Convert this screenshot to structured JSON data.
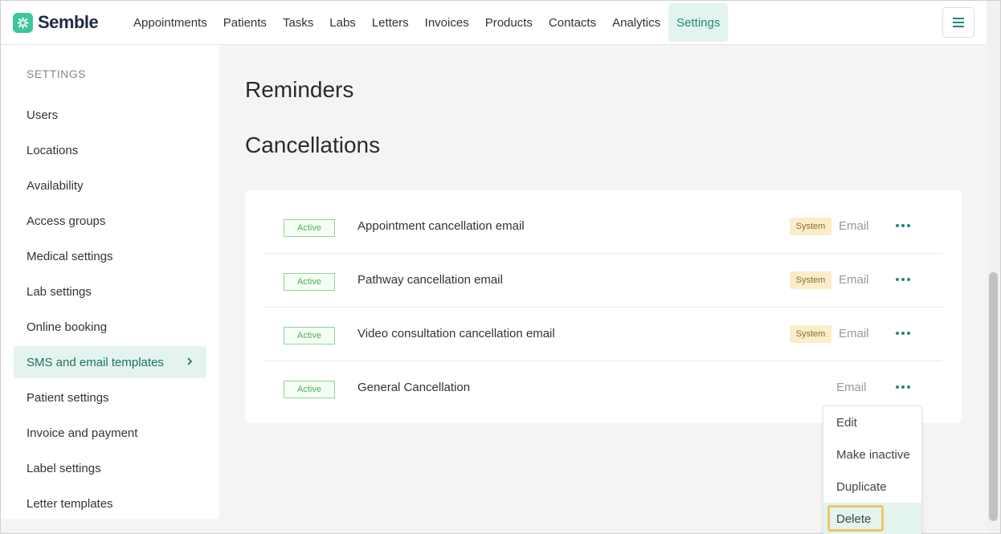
{
  "brand": {
    "name": "Semble",
    "color": "#3fc59b"
  },
  "nav": {
    "items": [
      "Appointments",
      "Patients",
      "Tasks",
      "Labs",
      "Letters",
      "Invoices",
      "Products",
      "Contacts",
      "Analytics",
      "Settings"
    ],
    "active": "Settings"
  },
  "sidebar": {
    "heading": "SETTINGS",
    "items": [
      {
        "label": "Users"
      },
      {
        "label": "Locations"
      },
      {
        "label": "Availability"
      },
      {
        "label": "Access groups"
      },
      {
        "label": "Medical settings"
      },
      {
        "label": "Lab settings"
      },
      {
        "label": "Online booking"
      },
      {
        "label": "SMS and email templates"
      },
      {
        "label": "Patient settings"
      },
      {
        "label": "Invoice and payment"
      },
      {
        "label": "Label settings"
      },
      {
        "label": "Letter templates"
      }
    ],
    "active": "SMS and email templates"
  },
  "main": {
    "section_reminders": "Reminders",
    "section_cancellations": "Cancellations",
    "templates": [
      {
        "status": "Active",
        "title": "Appointment cancellation email",
        "tag": "System",
        "type": "Email"
      },
      {
        "status": "Active",
        "title": "Pathway cancellation email",
        "tag": "System",
        "type": "Email"
      },
      {
        "status": "Active",
        "title": "Video consultation cancellation email",
        "tag": "System",
        "type": "Email"
      },
      {
        "status": "Active",
        "title": "General Cancellation",
        "tag": "",
        "type": "Email"
      }
    ]
  },
  "dropdown": {
    "items": [
      "Edit",
      "Make inactive",
      "Duplicate",
      "Delete"
    ],
    "highlighted": "Delete"
  },
  "colors": {
    "accent": "#1a8c78",
    "active_bg": "#e3f4ef",
    "system_bg": "#fbedc9",
    "highlight_border": "#f0c56a"
  }
}
